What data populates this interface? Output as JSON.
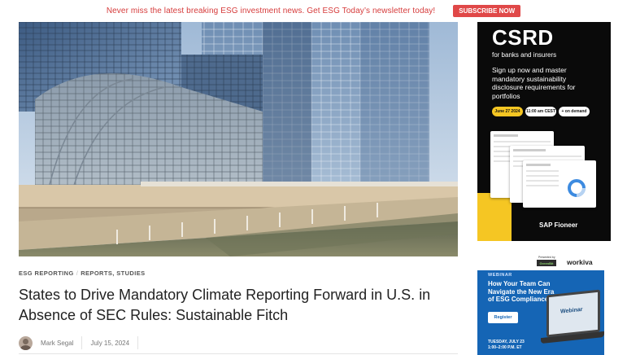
{
  "topbar": {
    "message": "Never miss the latest breaking ESG investment news. Get ESG Today’s newsletter today!",
    "button_label": "SUBSCRIBE NOW"
  },
  "article": {
    "categories": [
      "ESG REPORTING",
      "REPORTS, STUDIES"
    ],
    "category_separator": "/",
    "title": "States to Drive Mandatory Climate Reporting Forward in U.S. in Absence of SEC Rules: Sustainable Fitch",
    "author": "Mark Segal",
    "date": "July 15, 2024"
  },
  "ad_csrd": {
    "title": "CSRD",
    "subtitle": "for banks and insurers",
    "description": "Sign up now and master mandatory sustainability disclosure requirements for portfolios",
    "pill_date": "June 27 2024",
    "pill_time": "11:00 am CEST",
    "pill_demand": "+ on demand",
    "brand": "SAP Fioneer",
    "accent_color": "#f5c623"
  },
  "ad_workiva": {
    "presented_by": "Presented by",
    "partner_logo": "GreenBit",
    "brand": "workiva",
    "tag": "WEBINAR",
    "title": "How Your Team Can Navigate the New Era of ESG Compliance",
    "button_label": "Register",
    "laptop_label": "Webinar",
    "date_line1": "TUESDAY, JULY 23",
    "date_line2": "1:00–2:00 P.M. ET",
    "accent_color": "#1565b5"
  }
}
